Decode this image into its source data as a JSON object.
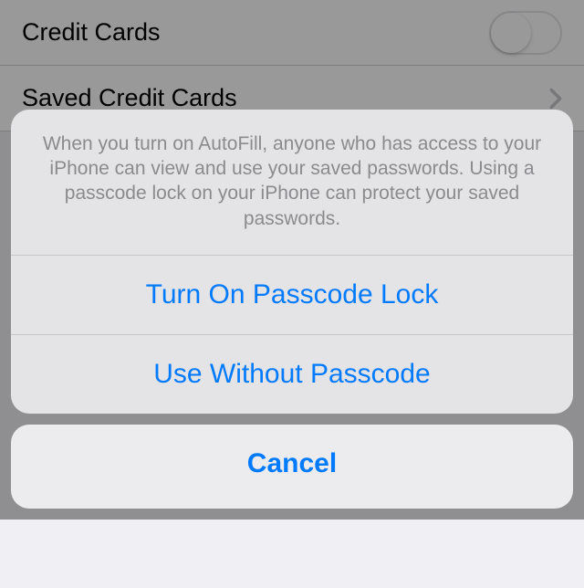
{
  "settings": {
    "rows": [
      {
        "label": "Credit Cards",
        "type": "toggle",
        "on": false
      },
      {
        "label": "Saved Credit Cards",
        "type": "link"
      }
    ]
  },
  "actionSheet": {
    "message": "When you turn on AutoFill, anyone who has access to your iPhone can view and use your saved passwords. Using a passcode lock on your iPhone can protect your saved passwords.",
    "actions": [
      "Turn On Passcode Lock",
      "Use Without Passcode"
    ],
    "cancel": "Cancel"
  }
}
